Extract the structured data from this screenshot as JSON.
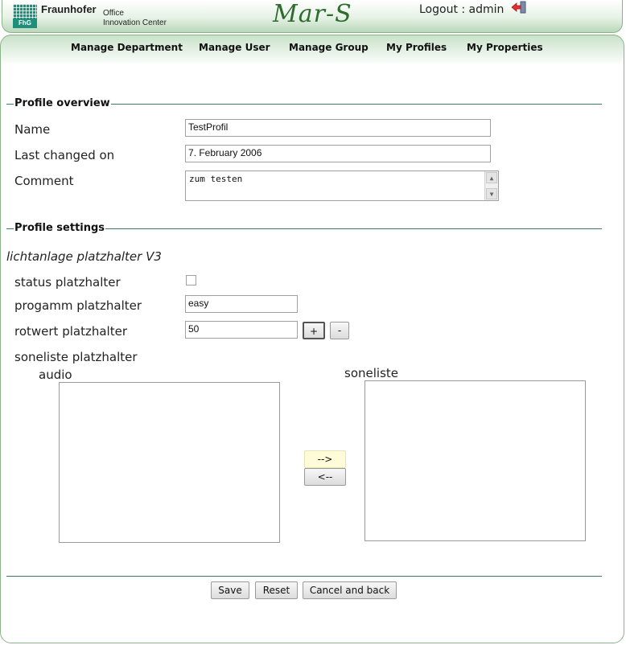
{
  "header": {
    "brand_name": "Fraunhofer",
    "brand_line1": "Office",
    "brand_line2": "Innovation Center",
    "logo_text": "FhG",
    "app_title": "Mar-S",
    "logout_label": "Logout : admin",
    "logout_icon": "logout-arrow-icon"
  },
  "nav": {
    "items": [
      {
        "label": "Manage Department"
      },
      {
        "label": "Manage User"
      },
      {
        "label": "Manage Group"
      },
      {
        "label": "My Profiles"
      },
      {
        "label": "My Properties"
      }
    ]
  },
  "overview": {
    "legend": "Profile overview",
    "name_label": "Name",
    "name_value": "TestProfil",
    "changed_label": "Last changed on",
    "changed_value": "7. February 2006",
    "comment_label": "Comment",
    "comment_value": "zum testen"
  },
  "settings": {
    "legend": "Profile settings",
    "section_title": "lichtanlage platzhalter V3",
    "status_label": "status platzhalter",
    "status_checked": false,
    "program_label": "progamm platzhalter",
    "program_value": "easy",
    "rot_label": "rotwert platzhalter",
    "rot_value": "50",
    "plus_label": "+",
    "minus_label": "-",
    "sone_label": "soneliste platzhalter",
    "audio_label": "audio",
    "soneliste_label": "soneliste",
    "move_right_label": "-->",
    "move_left_label": "<--"
  },
  "actions": {
    "save_label": "Save",
    "reset_label": "Reset",
    "cancel_label": "Cancel and back"
  },
  "colors": {
    "accent": "#2e6b2e",
    "rule": "#3a7a6a",
    "header_gradient_end": "#b9d8b9"
  }
}
